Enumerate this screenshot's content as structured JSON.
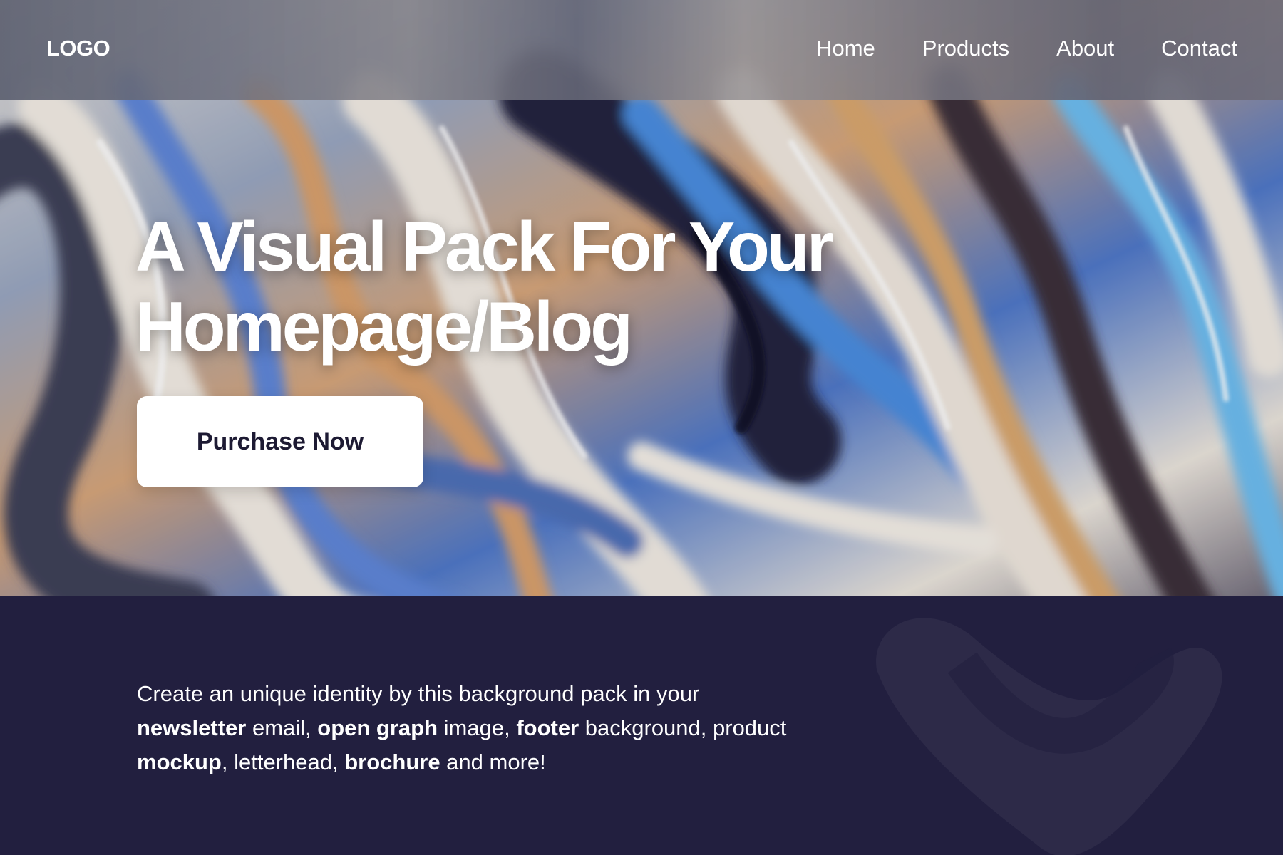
{
  "header": {
    "logo": "LOGO",
    "nav": [
      "Home",
      "Products",
      "About",
      "Contact"
    ]
  },
  "hero": {
    "title_line1": "A Visual Pack For Your",
    "title_line2": "Homepage/Blog",
    "cta_label": "Purchase Now"
  },
  "description": [
    {
      "text": "Create an unique identity by this background pack in your ",
      "bold": false
    },
    {
      "text": "newsletter",
      "bold": true
    },
    {
      "text": " email, ",
      "bold": false
    },
    {
      "text": "open graph",
      "bold": true
    },
    {
      "text": " image, ",
      "bold": false
    },
    {
      "text": "footer",
      "bold": true
    },
    {
      "text": " background, product ",
      "bold": false
    },
    {
      "text": "mockup",
      "bold": true
    },
    {
      "text": ", letterhead, ",
      "bold": false
    },
    {
      "text": "brochure",
      "bold": true
    },
    {
      "text": " and more!",
      "bold": false
    }
  ],
  "colors": {
    "section_bg": "#221f3f",
    "cta_bg": "#ffffff",
    "cta_text": "#1d1a33"
  }
}
